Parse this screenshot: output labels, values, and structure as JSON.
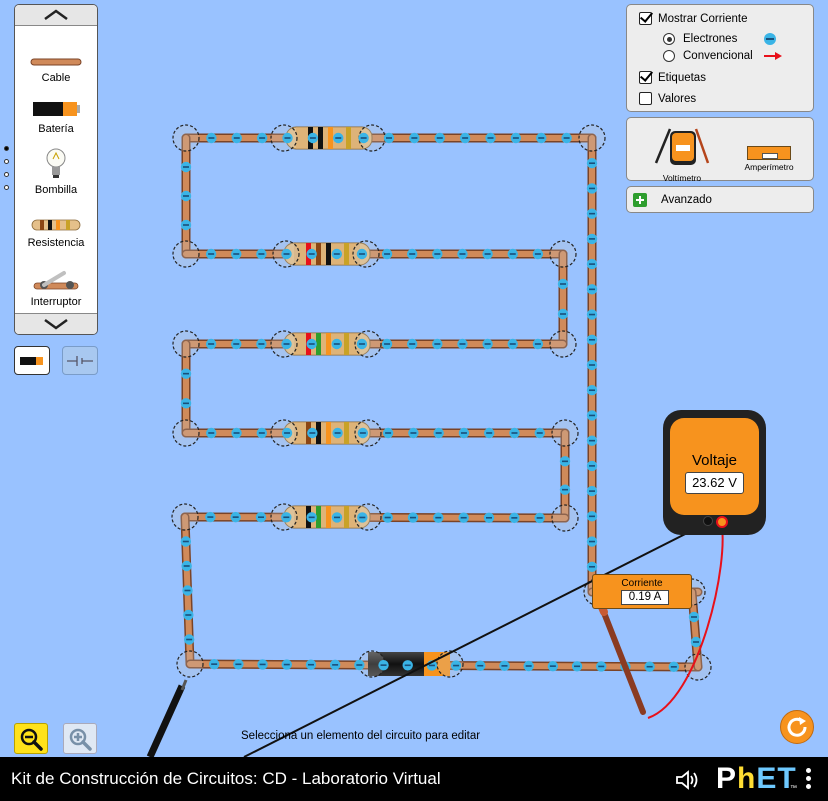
{
  "app": {
    "title": "Kit de Construcción de Circuitos: CD - Laboratorio Virtual",
    "logo_text": "PhET",
    "logo_mark": "™"
  },
  "toolbox": {
    "items": [
      {
        "label": "Cable",
        "icon": "wire-icon"
      },
      {
        "label": "Batería",
        "icon": "battery-icon"
      },
      {
        "label": "Bombilla",
        "icon": "lightbulb-icon"
      },
      {
        "label": "Resistencia",
        "icon": "resistor-icon"
      },
      {
        "label": "Interruptor",
        "icon": "switch-icon"
      }
    ],
    "page_count": 4,
    "active_page": 1
  },
  "view_toggle": {
    "options": [
      {
        "name": "lifelike-view",
        "selected": true
      },
      {
        "name": "schematic-view",
        "selected": false
      }
    ]
  },
  "display_panel": {
    "show_current": {
      "label": "Mostrar Corriente",
      "checked": true
    },
    "current_types": [
      {
        "label": "Electrones",
        "selected": true,
        "icon": "electron-icon"
      },
      {
        "label": "Convencional",
        "selected": false,
        "icon": "red-arrow-icon"
      }
    ],
    "labels": {
      "label": "Etiquetas",
      "checked": true
    },
    "values": {
      "label": "Valores",
      "checked": false
    }
  },
  "sensor_panel": {
    "voltmeter_label": "Voltímetro",
    "voltmeter_icon_title": "Voltaje",
    "ammeter_label": "Amperímetro",
    "ammeter_icon_title": "Corriente",
    "icon_placeholder_value": "?"
  },
  "advanced_panel": {
    "label": "Avanzado"
  },
  "voltmeter": {
    "title": "Voltaje",
    "reading": "23.62 V"
  },
  "ammeter": {
    "title": "Corriente",
    "reading": "0.19 A"
  },
  "status_text": "Selecciona un elemento del circuito para editar",
  "colors": {
    "background": "#99c2ff",
    "wire": "#d08a5a",
    "electron": "#3ab4e6",
    "meter_orange": "#f7931e",
    "probe_red": "#e8101a",
    "probe_black": "#111111"
  }
}
